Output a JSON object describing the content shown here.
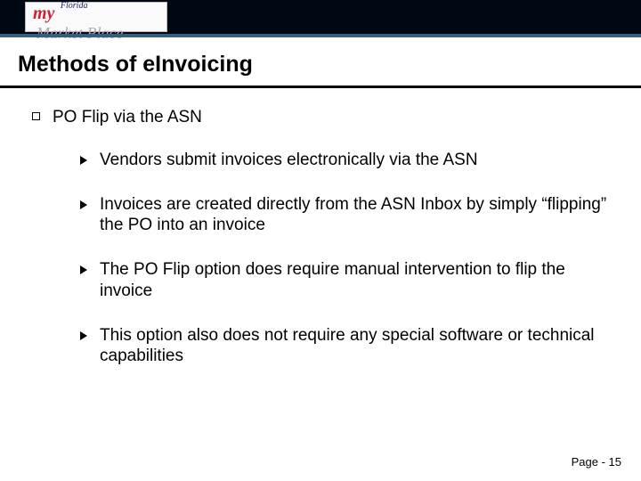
{
  "logo": {
    "my": "my",
    "florida": "Florida",
    "marketplace": "Market Place"
  },
  "title": "Methods of eInvoicing",
  "lvl1_heading": "PO Flip via the ASN",
  "subbullets": {
    "0": "Vendors submit invoices electronically via the ASN",
    "1": "Invoices are created directly from the ASN Inbox by simply “flipping” the PO into an invoice",
    "2": "The PO Flip option does require manual intervention to flip the invoice",
    "3": "This option also does not require any special software or technical capabilities"
  },
  "footer": "Page - 15"
}
